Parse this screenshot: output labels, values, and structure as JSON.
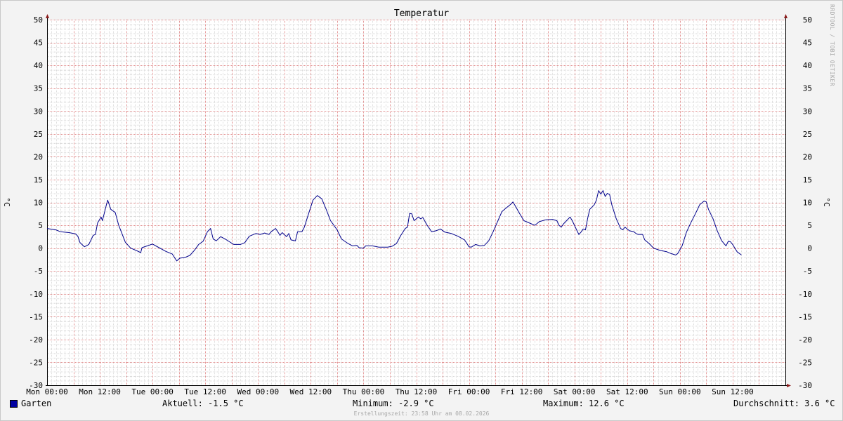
{
  "chart_data": {
    "type": "line",
    "title": "Temperatur",
    "ylabel": "°C",
    "ylim": [
      -30,
      50
    ],
    "yticks": [
      50,
      45,
      40,
      35,
      30,
      25,
      20,
      15,
      10,
      5,
      0,
      -5,
      -10,
      -15,
      -20,
      -25,
      -30
    ],
    "xlim": [
      0,
      168
    ],
    "x_unit": "hours",
    "xticks": [
      {
        "hour": 0,
        "label": "Mon 00:00"
      },
      {
        "hour": 12,
        "label": "Mon 12:00"
      },
      {
        "hour": 24,
        "label": "Tue 00:00"
      },
      {
        "hour": 36,
        "label": "Tue 12:00"
      },
      {
        "hour": 48,
        "label": "Wed 00:00"
      },
      {
        "hour": 60,
        "label": "Wed 12:00"
      },
      {
        "hour": 72,
        "label": "Thu 00:00"
      },
      {
        "hour": 84,
        "label": "Thu 12:00"
      },
      {
        "hour": 96,
        "label": "Fri 00:00"
      },
      {
        "hour": 108,
        "label": "Fri 12:00"
      },
      {
        "hour": 120,
        "label": "Sat 00:00"
      },
      {
        "hour": 132,
        "label": "Sat 12:00"
      },
      {
        "hour": 144,
        "label": "Sun 00:00"
      },
      {
        "hour": 156,
        "label": "Sun 12:00"
      }
    ],
    "grid": true,
    "line_color": "#00008b",
    "series": [
      {
        "name": "Garten",
        "color": "#0000a0",
        "points": [
          [
            0,
            4.3
          ],
          [
            2,
            4.0
          ],
          [
            3,
            3.6
          ],
          [
            5,
            3.4
          ],
          [
            6.5,
            3.1
          ],
          [
            7,
            2.6
          ],
          [
            7.5,
            1.2
          ],
          [
            8.5,
            0.3
          ],
          [
            9.5,
            0.8
          ],
          [
            10.5,
            2.8
          ],
          [
            11,
            3.0
          ],
          [
            11.5,
            5.5
          ],
          [
            12.3,
            6.8
          ],
          [
            12.6,
            6.0
          ],
          [
            13.5,
            9.5
          ],
          [
            13.8,
            10.5
          ],
          [
            14.5,
            8.5
          ],
          [
            15.5,
            7.8
          ],
          [
            16.3,
            5.0
          ],
          [
            17.8,
            1.3
          ],
          [
            19,
            0.0
          ],
          [
            20.5,
            -0.6
          ],
          [
            21.3,
            -1.0
          ],
          [
            21.6,
            0.1
          ],
          [
            22.5,
            0.4
          ],
          [
            24,
            0.9
          ],
          [
            25.5,
            0.1
          ],
          [
            27,
            -0.7
          ],
          [
            28.5,
            -1.3
          ],
          [
            29.5,
            -2.8
          ],
          [
            30.2,
            -2.2
          ],
          [
            31.5,
            -2.0
          ],
          [
            32.5,
            -1.6
          ],
          [
            33.5,
            -0.5
          ],
          [
            34.5,
            0.8
          ],
          [
            35.5,
            1.5
          ],
          [
            36.5,
            3.6
          ],
          [
            37.2,
            4.3
          ],
          [
            37.8,
            2.0
          ],
          [
            38.5,
            1.6
          ],
          [
            39.5,
            2.5
          ],
          [
            40.5,
            2.0
          ],
          [
            41.5,
            1.4
          ],
          [
            42.5,
            0.8
          ],
          [
            44,
            0.8
          ],
          [
            45,
            1.2
          ],
          [
            46,
            2.6
          ],
          [
            47.5,
            3.2
          ],
          [
            48.5,
            3.0
          ],
          [
            49.5,
            3.3
          ],
          [
            50.5,
            3.0
          ],
          [
            51,
            3.6
          ],
          [
            52,
            4.3
          ],
          [
            52.5,
            3.6
          ],
          [
            53,
            2.8
          ],
          [
            53.5,
            3.4
          ],
          [
            54.5,
            2.5
          ],
          [
            55,
            3.2
          ],
          [
            55.5,
            1.8
          ],
          [
            56.5,
            1.6
          ],
          [
            57,
            3.6
          ],
          [
            58,
            3.6
          ],
          [
            58.5,
            4.5
          ],
          [
            59.5,
            7.5
          ],
          [
            60.5,
            10.5
          ],
          [
            61.5,
            11.5
          ],
          [
            62.5,
            10.8
          ],
          [
            63.5,
            8.5
          ],
          [
            64.5,
            6.0
          ],
          [
            66,
            4.0
          ],
          [
            67,
            2.0
          ],
          [
            68.5,
            1.0
          ],
          [
            69.5,
            0.5
          ],
          [
            70.5,
            0.6
          ],
          [
            71,
            0.1
          ],
          [
            72,
            0.0
          ],
          [
            72.5,
            0.5
          ],
          [
            74,
            0.5
          ],
          [
            75.5,
            0.2
          ],
          [
            77.5,
            0.2
          ],
          [
            78.5,
            0.4
          ],
          [
            79.5,
            1.0
          ],
          [
            80.5,
            2.8
          ],
          [
            81.5,
            4.3
          ],
          [
            82,
            4.6
          ],
          [
            82.5,
            7.6
          ],
          [
            83,
            7.5
          ],
          [
            83.5,
            6.0
          ],
          [
            84.5,
            6.8
          ],
          [
            85,
            6.4
          ],
          [
            85.5,
            6.7
          ],
          [
            86.5,
            5.0
          ],
          [
            87.5,
            3.6
          ],
          [
            88.5,
            3.8
          ],
          [
            89.5,
            4.2
          ],
          [
            90.5,
            3.5
          ],
          [
            92,
            3.2
          ],
          [
            93.5,
            2.6
          ],
          [
            95,
            1.8
          ],
          [
            96,
            0.3
          ],
          [
            96.5,
            0.2
          ],
          [
            97.5,
            0.8
          ],
          [
            98.5,
            0.5
          ],
          [
            99.5,
            0.6
          ],
          [
            100.5,
            1.6
          ],
          [
            101.5,
            3.6
          ],
          [
            102.5,
            5.8
          ],
          [
            103.5,
            8.0
          ],
          [
            104.5,
            8.8
          ],
          [
            105.5,
            9.6
          ],
          [
            106,
            10.1
          ],
          [
            106.5,
            9.3
          ],
          [
            107.5,
            7.6
          ],
          [
            108.5,
            6.0
          ],
          [
            110,
            5.4
          ],
          [
            111,
            5.0
          ],
          [
            112,
            5.8
          ],
          [
            113.5,
            6.2
          ],
          [
            115,
            6.3
          ],
          [
            116,
            6.0
          ],
          [
            116.5,
            5.0
          ],
          [
            117,
            4.6
          ],
          [
            117.5,
            5.3
          ],
          [
            118.5,
            6.3
          ],
          [
            119,
            6.8
          ],
          [
            119.5,
            6.0
          ],
          [
            120.5,
            4.0
          ],
          [
            121,
            3.0
          ],
          [
            121.5,
            3.5
          ],
          [
            122,
            4.2
          ],
          [
            122.5,
            4.0
          ],
          [
            123,
            6.5
          ],
          [
            123.5,
            8.5
          ],
          [
            124.5,
            9.5
          ],
          [
            125,
            10.5
          ],
          [
            125.5,
            12.6
          ],
          [
            126,
            11.8
          ],
          [
            126.5,
            12.6
          ],
          [
            127,
            11.3
          ],
          [
            127.5,
            12.0
          ],
          [
            128,
            11.7
          ],
          [
            128.5,
            9.5
          ],
          [
            129.5,
            6.5
          ],
          [
            130.5,
            4.3
          ],
          [
            131,
            4.0
          ],
          [
            131.5,
            4.6
          ],
          [
            132.5,
            3.8
          ],
          [
            133.5,
            3.6
          ],
          [
            134,
            3.2
          ],
          [
            134.5,
            3.0
          ],
          [
            135.5,
            3.0
          ],
          [
            136,
            1.8
          ],
          [
            137,
            1.0
          ],
          [
            138,
            0.0
          ],
          [
            139.5,
            -0.5
          ],
          [
            141,
            -0.8
          ],
          [
            142,
            -1.2
          ],
          [
            143,
            -1.5
          ],
          [
            143.5,
            -1.2
          ],
          [
            144.5,
            0.5
          ],
          [
            145.5,
            3.5
          ],
          [
            146.5,
            5.6
          ],
          [
            147.5,
            7.5
          ],
          [
            148.5,
            9.5
          ],
          [
            149.5,
            10.3
          ],
          [
            150,
            10.1
          ],
          [
            150.5,
            8.5
          ],
          [
            151.5,
            6.5
          ],
          [
            152.5,
            3.8
          ],
          [
            153.5,
            1.6
          ],
          [
            154.5,
            0.5
          ],
          [
            155,
            1.5
          ],
          [
            155.5,
            1.4
          ],
          [
            156,
            0.8
          ],
          [
            157,
            -0.8
          ],
          [
            158,
            -1.5
          ]
        ]
      }
    ]
  },
  "legend": {
    "series_label": "Garten",
    "series_color": "#0000a0",
    "current": "Aktuell: -1.5 °C",
    "minimum": "Minimum: -2.9 °C",
    "maximum": "Maximum: 12.6 °C",
    "average": "Durchschnitt: 3.6 °C"
  },
  "credit": "RRDTOOL / TOBI OETIKER",
  "created": "Erstellungszeit: 23:58 Uhr am 08.02.2026"
}
